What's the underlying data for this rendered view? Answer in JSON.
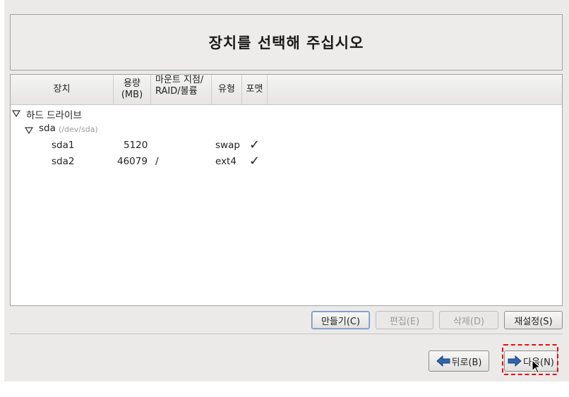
{
  "header": {
    "title": "장치를 선택해 주십시오"
  },
  "tree": {
    "columns": {
      "device": "장치",
      "size_line1": "용량",
      "size_line2": "(MB)",
      "mount_line1": "마운트 지점/",
      "mount_line2": "RAID/볼륨",
      "type": "유형",
      "format": "포맷"
    },
    "group": {
      "label": "하드 드라이브"
    },
    "disk": {
      "name": "sda",
      "path": "(/dev/sda)"
    },
    "partitions": [
      {
        "name": "sda1",
        "size": "5120",
        "mount": "",
        "type": "swap",
        "format": "✓"
      },
      {
        "name": "sda2",
        "size": "46079",
        "mount": "/",
        "type": "ext4",
        "format": "✓"
      }
    ]
  },
  "actions": {
    "create": "만들기(C)",
    "edit": "편집(E)",
    "delete": "삭제(D)",
    "reset": "재설정(S)"
  },
  "nav": {
    "back": "뒤로(B)",
    "next": "다음(N)"
  },
  "colors": {
    "window_bg": "#ebeae9",
    "arrow_blue": "#2f64b4",
    "highlight_red": "#e01010"
  },
  "icons": {
    "expand": "triangle-down-icon",
    "check": "check-icon",
    "back": "arrow-left-icon",
    "next": "arrow-right-icon"
  }
}
